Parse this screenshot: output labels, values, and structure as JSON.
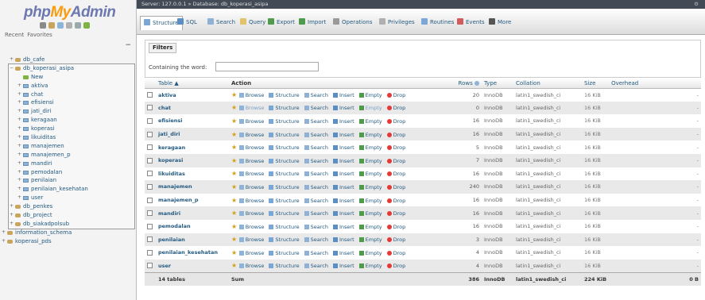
{
  "app": {
    "logo": {
      "php": "php",
      "my": "My",
      "admin": "Admin"
    },
    "recent_label": "Recent",
    "favorites_label": "Favorites"
  },
  "breadcrumb": {
    "server": "Server: 127.0.0.1",
    "database": "Database: db_koperasi_asipa"
  },
  "tabs": [
    {
      "label": "Structure",
      "icon": "structure-icon",
      "color": "#7aa7d6"
    },
    {
      "label": "SQL",
      "icon": "sql-icon",
      "color": "#5b8ec4"
    },
    {
      "label": "Search",
      "icon": "search-icon",
      "color": "#8fb1d6"
    },
    {
      "label": "Query",
      "icon": "query-icon",
      "color": "#e2c36b"
    },
    {
      "label": "Export",
      "icon": "export-icon",
      "color": "#4f9a4b"
    },
    {
      "label": "Import",
      "icon": "import-icon",
      "color": "#4f9a4b"
    },
    {
      "label": "Operations",
      "icon": "wrench-icon",
      "color": "#9a9a9a"
    },
    {
      "label": "Privileges",
      "icon": "privileges-icon",
      "color": "#b0b0b0"
    },
    {
      "label": "Routines",
      "icon": "routines-icon",
      "color": "#7aa7d6"
    },
    {
      "label": "Events",
      "icon": "events-icon",
      "color": "#d45b5b"
    },
    {
      "label": "More",
      "icon": "chevron-down-icon",
      "color": "#555555"
    }
  ],
  "filters": {
    "legend": "Filters",
    "label": "Containing the word:",
    "value": ""
  },
  "tree": [
    {
      "label": "db_cafe",
      "type": "db",
      "level": 0
    },
    {
      "label": "db_koperasi_asipa",
      "type": "db",
      "level": 0
    },
    {
      "label": "New",
      "type": "new",
      "level": 1
    },
    {
      "label": "aktiva",
      "type": "table",
      "level": 1
    },
    {
      "label": "chat",
      "type": "table",
      "level": 1
    },
    {
      "label": "efisiensi",
      "type": "table",
      "level": 1
    },
    {
      "label": "jati_diri",
      "type": "table",
      "level": 1
    },
    {
      "label": "keragaan",
      "type": "table",
      "level": 1
    },
    {
      "label": "koperasi",
      "type": "table",
      "level": 1
    },
    {
      "label": "likuiditas",
      "type": "table",
      "level": 1
    },
    {
      "label": "manajemen",
      "type": "table",
      "level": 1
    },
    {
      "label": "manajemen_p",
      "type": "table",
      "level": 1
    },
    {
      "label": "mandiri",
      "type": "table",
      "level": 1
    },
    {
      "label": "pemodalan",
      "type": "table",
      "level": 1
    },
    {
      "label": "penilaian",
      "type": "table",
      "level": 1
    },
    {
      "label": "penilaian_kesehatan",
      "type": "table",
      "level": 1
    },
    {
      "label": "user",
      "type": "table",
      "level": 1
    },
    {
      "label": "db_penkes",
      "type": "db",
      "level": 0
    },
    {
      "label": "db_project",
      "type": "db",
      "level": 0
    },
    {
      "label": "db_siakadpolsub",
      "type": "db",
      "level": 0
    },
    {
      "label": "information_schema",
      "type": "db",
      "level": -1
    },
    {
      "label": "koperasi_pds",
      "type": "db",
      "level": -1
    }
  ],
  "table": {
    "headers": {
      "table": "Table",
      "action": "Action",
      "rows": "Rows",
      "type": "Type",
      "collation": "Collation",
      "size": "Size",
      "overhead": "Overhead"
    },
    "actions": [
      "Browse",
      "Structure",
      "Search",
      "Insert",
      "Empty",
      "Drop"
    ],
    "rows": [
      {
        "name": "aktiva",
        "rows": "20",
        "type": "InnoDB",
        "collation": "latin1_swedish_ci",
        "size": "16 KiB",
        "overhead": "-"
      },
      {
        "name": "chat",
        "rows": "0",
        "type": "InnoDB",
        "collation": "latin1_swedish_ci",
        "size": "16 KiB",
        "overhead": "-"
      },
      {
        "name": "efisiensi",
        "rows": "16",
        "type": "InnoDB",
        "collation": "latin1_swedish_ci",
        "size": "16 KiB",
        "overhead": "-"
      },
      {
        "name": "jati_diri",
        "rows": "16",
        "type": "InnoDB",
        "collation": "latin1_swedish_ci",
        "size": "16 KiB",
        "overhead": "-"
      },
      {
        "name": "keragaan",
        "rows": "5",
        "type": "InnoDB",
        "collation": "latin1_swedish_ci",
        "size": "16 KiB",
        "overhead": "-"
      },
      {
        "name": "koperasi",
        "rows": "7",
        "type": "InnoDB",
        "collation": "latin1_swedish_ci",
        "size": "16 KiB",
        "overhead": "-"
      },
      {
        "name": "likuiditas",
        "rows": "16",
        "type": "InnoDB",
        "collation": "latin1_swedish_ci",
        "size": "16 KiB",
        "overhead": "-"
      },
      {
        "name": "manajemen",
        "rows": "240",
        "type": "InnoDB",
        "collation": "latin1_swedish_ci",
        "size": "16 KiB",
        "overhead": "-"
      },
      {
        "name": "manajemen_p",
        "rows": "16",
        "type": "InnoDB",
        "collation": "latin1_swedish_ci",
        "size": "16 KiB",
        "overhead": "-"
      },
      {
        "name": "mandiri",
        "rows": "16",
        "type": "InnoDB",
        "collation": "latin1_swedish_ci",
        "size": "16 KiB",
        "overhead": "-"
      },
      {
        "name": "pemodalan",
        "rows": "16",
        "type": "InnoDB",
        "collation": "latin1_swedish_ci",
        "size": "16 KiB",
        "overhead": "-"
      },
      {
        "name": "penilaian",
        "rows": "3",
        "type": "InnoDB",
        "collation": "latin1_swedish_ci",
        "size": "16 KiB",
        "overhead": "-"
      },
      {
        "name": "penilaian_kesehatan",
        "rows": "4",
        "type": "InnoDB",
        "collation": "latin1_swedish_ci",
        "size": "16 KiB",
        "overhead": "-"
      },
      {
        "name": "user",
        "rows": "4",
        "type": "InnoDB",
        "collation": "latin1_swedish_ci",
        "size": "16 KiB",
        "overhead": "-"
      }
    ],
    "summary": {
      "tables": "14 tables",
      "label": "Sum",
      "rows": "386",
      "type": "InnoDB",
      "collation": "latin1_swedish_ci",
      "size": "224 KiB",
      "overhead": "0 B"
    }
  }
}
